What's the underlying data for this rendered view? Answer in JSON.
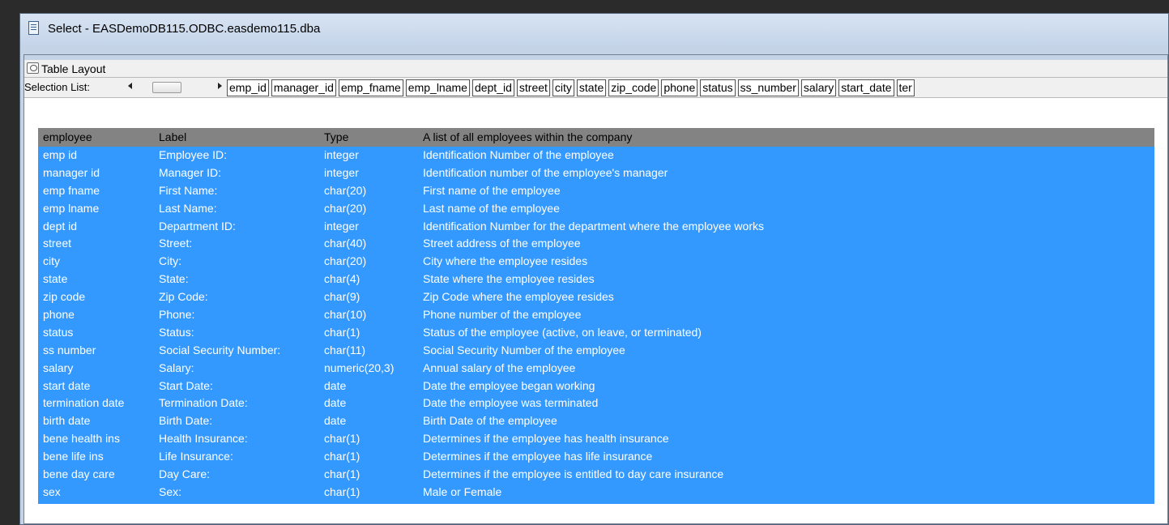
{
  "window": {
    "title": "Select - EASDemoDB115.ODBC.easdemo115.dba"
  },
  "subwindow": {
    "title": "Table Layout"
  },
  "selection_list": {
    "label": "Selection List:",
    "columns": [
      "emp_id",
      "manager_id",
      "emp_fname",
      "emp_lname",
      "dept_id",
      "street",
      "city",
      "state",
      "zip_code",
      "phone",
      "status",
      "ss_number",
      "salary",
      "start_date",
      "ter"
    ]
  },
  "grid": {
    "headers": [
      "employee",
      "Label",
      "Type",
      "A list of all employees within the company"
    ],
    "rows": [
      {
        "name": "emp id",
        "label": "Employee ID:",
        "type": "integer",
        "desc": "Identification Number of the employee"
      },
      {
        "name": "manager id",
        "label": "Manager ID:",
        "type": "integer",
        "desc": "Identification number of the employee's manager"
      },
      {
        "name": "emp fname",
        "label": "First Name:",
        "type": "char(20)",
        "desc": "First name of the employee"
      },
      {
        "name": "emp lname",
        "label": "Last Name:",
        "type": "char(20)",
        "desc": "Last name of the employee"
      },
      {
        "name": "dept id",
        "label": "Department ID:",
        "type": "integer",
        "desc": "Identification Number for the department where the employee works"
      },
      {
        "name": "street",
        "label": "Street:",
        "type": "char(40)",
        "desc": "Street address of the employee"
      },
      {
        "name": "city",
        "label": "City:",
        "type": "char(20)",
        "desc": "City where the employee resides"
      },
      {
        "name": "state",
        "label": "State:",
        "type": "char(4)",
        "desc": "State where the employee resides"
      },
      {
        "name": "zip code",
        "label": "Zip Code:",
        "type": "char(9)",
        "desc": "Zip Code where the employee resides"
      },
      {
        "name": "phone",
        "label": "Phone:",
        "type": "char(10)",
        "desc": "Phone number of the employee"
      },
      {
        "name": "status",
        "label": "Status:",
        "type": "char(1)",
        "desc": "Status of the employee (active, on leave, or terminated)"
      },
      {
        "name": "ss number",
        "label": "Social Security Number:",
        "type": "char(11)",
        "desc": "Social Security Number of the employee"
      },
      {
        "name": "salary",
        "label": "Salary:",
        "type": "numeric(20,3)",
        "desc": "Annual salary of the employee"
      },
      {
        "name": "start date",
        "label": "Start Date:",
        "type": "date",
        "desc": "Date the employee began working"
      },
      {
        "name": "termination date",
        "label": "Termination Date:",
        "type": "date",
        "desc": "Date the employee was terminated"
      },
      {
        "name": "birth date",
        "label": "Birth Date:",
        "type": "date",
        "desc": "Birth Date of the employee"
      },
      {
        "name": "bene health ins",
        "label": "Health Insurance:",
        "type": "char(1)",
        "desc": "Determines if the employee has health insurance"
      },
      {
        "name": "bene life ins",
        "label": "Life Insurance:",
        "type": "char(1)",
        "desc": "Determines if the employee has life insurance"
      },
      {
        "name": "bene day care",
        "label": "Day Care:",
        "type": "char(1)",
        "desc": "Determines if the employee is entitled to day care insurance"
      },
      {
        "name": "sex",
        "label": "Sex:",
        "type": "char(1)",
        "desc": "Male or Female"
      }
    ]
  },
  "colors": {
    "selection": "#3399ff",
    "header": "#838383",
    "frame": "#c5d3e6"
  }
}
